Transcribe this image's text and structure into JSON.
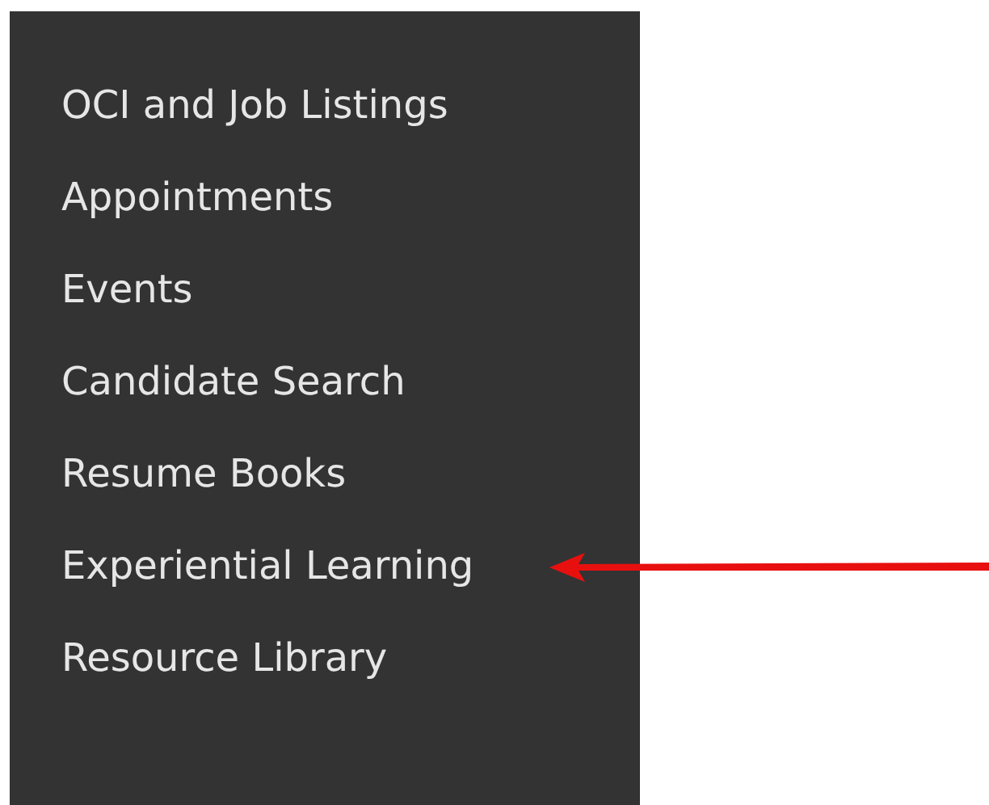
{
  "sidebar": {
    "items": [
      {
        "label": "OCI and Job Listings",
        "pointed": false
      },
      {
        "label": "Appointments",
        "pointed": false
      },
      {
        "label": "Events",
        "pointed": false
      },
      {
        "label": "Candidate Search",
        "pointed": false
      },
      {
        "label": "Resume Books",
        "pointed": false
      },
      {
        "label": "Experiential Learning",
        "pointed": true
      },
      {
        "label": "Resource Library",
        "pointed": false
      }
    ]
  }
}
